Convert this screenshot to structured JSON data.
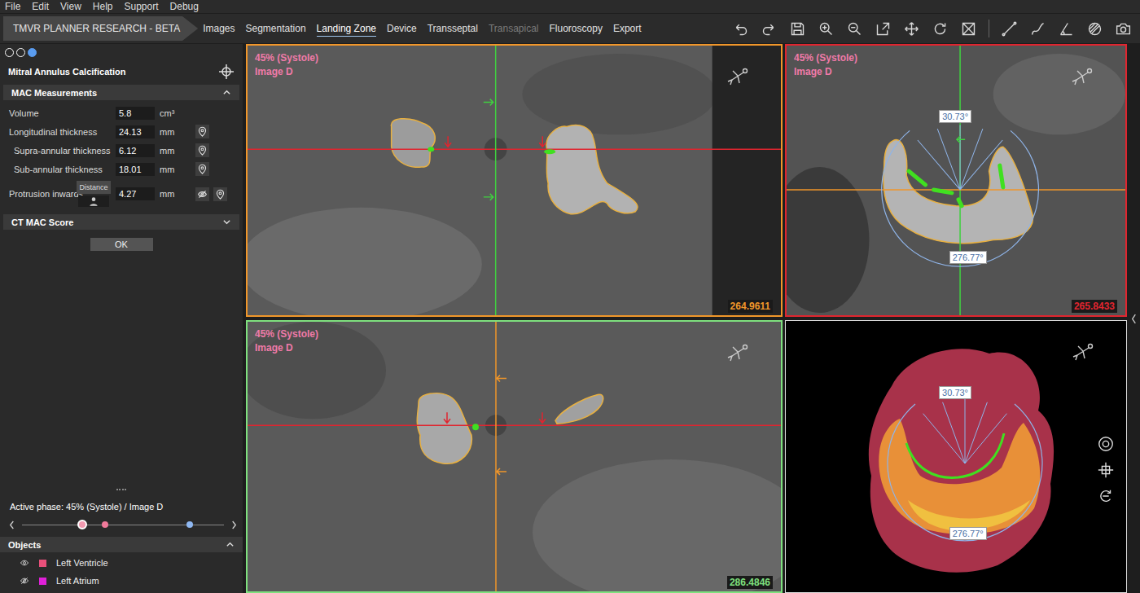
{
  "menu": [
    "File",
    "Edit",
    "View",
    "Help",
    "Support",
    "Debug"
  ],
  "app_title": "TMVR PLANNER RESEARCH - BETA",
  "tabs": [
    {
      "label": "Images",
      "selected": false,
      "disabled": false
    },
    {
      "label": "Segmentation",
      "selected": false,
      "disabled": false
    },
    {
      "label": "Landing Zone",
      "selected": true,
      "disabled": false
    },
    {
      "label": "Device",
      "selected": false,
      "disabled": false
    },
    {
      "label": "Transseptal",
      "selected": false,
      "disabled": false
    },
    {
      "label": "Transapical",
      "selected": false,
      "disabled": true
    },
    {
      "label": "Fluoroscopy",
      "selected": false,
      "disabled": false
    },
    {
      "label": "Export",
      "selected": false,
      "disabled": false
    }
  ],
  "panel": {
    "steps": [
      {
        "selected": false
      },
      {
        "selected": false
      },
      {
        "selected": true
      }
    ],
    "title": "Mitral Annulus Calcification",
    "measurements": {
      "title": "MAC Measurements",
      "expanded": true,
      "rows": [
        {
          "label": "Volume",
          "value": "5.8",
          "unit": "cm³",
          "kind": "plain",
          "indent": false
        },
        {
          "label": "Longitudinal thickness",
          "value": "24.13",
          "unit": "mm",
          "kind": "pin",
          "indent": false
        },
        {
          "label": "Supra-annular thickness",
          "value": "6.12",
          "unit": "mm",
          "kind": "pin",
          "indent": true
        },
        {
          "label": "Sub-annular thickness",
          "value": "18.01",
          "unit": "mm",
          "kind": "pin",
          "indent": true
        },
        {
          "label": "Protrusion inwards",
          "value": "4.27",
          "unit": "mm",
          "kind": "distance",
          "indent": false,
          "button": "Distance",
          "visible": false
        }
      ]
    },
    "score": {
      "title": "CT MAC Score",
      "expanded": false
    },
    "ok_button": "OK",
    "active_phase": "Active phase: 45% (Systole) / Image D",
    "timeline": [
      {
        "level": 0.3,
        "color": "#f29ab0",
        "selected": true
      },
      {
        "level": 0.41,
        "color": "#f07a9a",
        "selected": false
      },
      {
        "level": 0.83,
        "color": "#8fb8f2",
        "selected": false
      }
    ],
    "objects": {
      "title": "Objects",
      "expanded": true,
      "items": [
        {
          "name": "Left Ventricle",
          "visible": true,
          "color": "#e8507a"
        },
        {
          "name": "Left Atrium",
          "visible": false,
          "color": "#e020d8"
        }
      ]
    }
  },
  "viewports": [
    {
      "phase": "45% (Systole)",
      "image": "Image D",
      "value": "264.9611",
      "color": "#f0962a",
      "kind": "long-a",
      "angles": []
    },
    {
      "phase": "45% (Systole)",
      "image": "Image D",
      "value": "265.8433",
      "color": "#e0252f",
      "kind": "short",
      "angles": [
        "30.73°",
        "276.77°"
      ]
    },
    {
      "phase": "45% (Systole)",
      "image": "Image D",
      "value": "286.4846",
      "color": "#7ee07e",
      "kind": "long-b",
      "angles": []
    },
    {
      "phase": "",
      "image": "",
      "value": "",
      "color": "#dddddd",
      "kind": "render",
      "angles": [
        "30.73°",
        "276.77°"
      ]
    }
  ]
}
